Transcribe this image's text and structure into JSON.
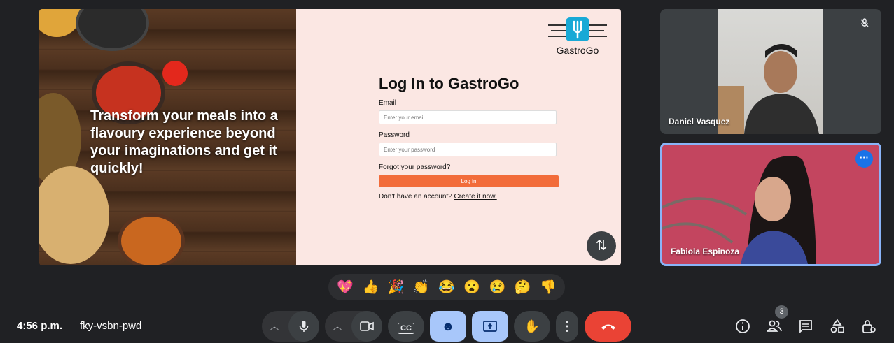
{
  "presentation": {
    "tagline": "Transform your meals into a flavoury experience beyond your imaginations and get it quickly!",
    "logo_name": "GastroGo",
    "login": {
      "heading": "Log In to GastroGo",
      "email_label": "Email",
      "email_placeholder": "Enter your email",
      "password_label": "Password",
      "password_placeholder": "Enter your password",
      "forgot_link": "Forgot your password?",
      "login_button": "Log in",
      "signup_prompt": "Don't have an account?",
      "signup_link": "Create it now."
    },
    "swap_icon": "swap-vertical-icon"
  },
  "participants": [
    {
      "name": "Daniel Vasquez",
      "muted": true
    },
    {
      "name": "Fabiola Espinoza",
      "muted": false
    }
  ],
  "reactions": [
    "💖",
    "👍",
    "🎉",
    "👏",
    "😂",
    "😮",
    "😢",
    "🤔",
    "👎"
  ],
  "footer": {
    "time": "4:56 p.m.",
    "meeting_code": "fky-vsbn-pwd",
    "people_count": "3"
  },
  "colors": {
    "background": "#202124",
    "accent_orange": "#f26c3a",
    "active_blue": "#a8c7fa",
    "end_call_red": "#ea4335",
    "speaker_border": "#8ab4f8"
  }
}
